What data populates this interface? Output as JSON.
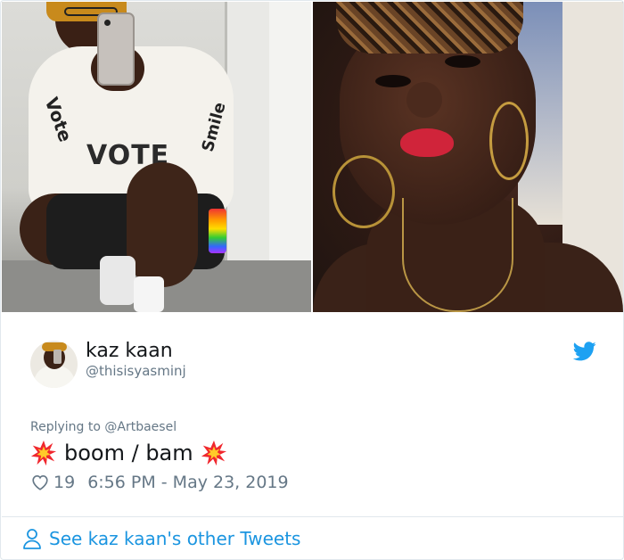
{
  "media": {
    "left_photo": {
      "sweatshirt_text": "VOTE",
      "sleeve_text_left": "Vote",
      "sleeve_text_right": "Smile"
    },
    "right_photo": {}
  },
  "tweet": {
    "display_name": "kaz kaan",
    "handle": "@thisisyasminj",
    "reply_prefix": "Replying to",
    "reply_to": "@Artbaesel",
    "text": "boom / bam",
    "emoji_left": "collision-emoji",
    "emoji_right": "collision-emoji",
    "like_count": "19",
    "timestamp": "6:56 PM - May 23, 2019"
  },
  "footer": {
    "see_more_label": "See kaz kaan's other Tweets"
  },
  "colors": {
    "link_blue": "#1b95e0",
    "twitter_blue": "#1da1f2",
    "secondary_text": "#657786",
    "primary_text": "#14171a",
    "border": "#e1e8ed"
  },
  "icons": {
    "brand": "twitter-bird-icon",
    "like": "heart-icon",
    "profile": "person-icon"
  }
}
